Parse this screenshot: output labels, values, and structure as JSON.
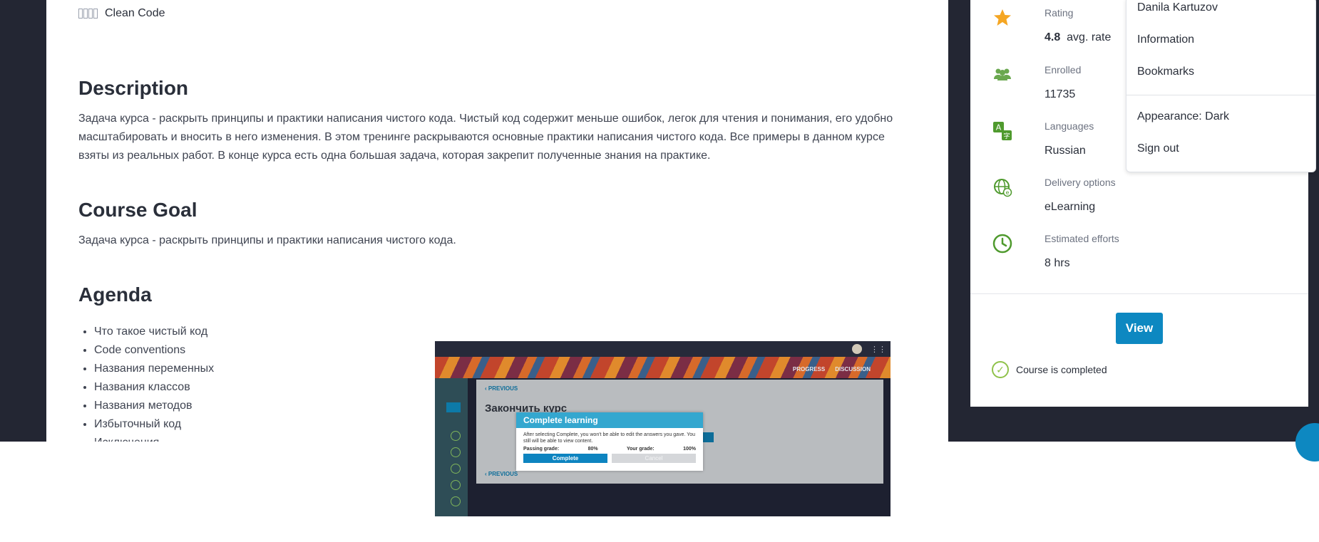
{
  "course": {
    "tag_label": "Clean Code"
  },
  "description": {
    "heading": "Description",
    "text": " Задача курса - раскрыть принципы и практики написания чистого кода. Чистый код содержит меньше ошибок, легок для чтения и понимания, его удобно масштабировать и вносить в него изменения. В этом тренинге раскрываются основные практики написания чистого кода. Все примеры в данном курсе взяты из реальных работ. В конце курса есть одна большая задача, которая закрепит полученные знания на практике."
  },
  "goal": {
    "heading": "Course Goal",
    "text": "Задача курса - раскрыть принципы и практики написания чистого кода."
  },
  "agenda": {
    "heading": "Agenda",
    "items": [
      "Что такое чистый код",
      "Code conventions",
      "Названия переменных",
      "Названия классов",
      "Названия методов",
      "Избыточный код",
      "Исключения"
    ]
  },
  "screenshot": {
    "nav_progress": "PROGRESS",
    "nav_discussion": "DISCUSSION",
    "previous": "PREVIOUS",
    "heading": "Закончить курс",
    "modal_title": "Complete learning",
    "modal_text": "After selecting Complete, you won't be able to edit the answers you gave. You still will be able to view content.",
    "passing_label": "Passing grade:",
    "passing_value": "80%",
    "your_label": "Your grade:",
    "your_value": "100%",
    "complete_btn": "Complete",
    "cancel_btn": "Cancel"
  },
  "info": {
    "rating_label": "Rating",
    "rating_value": "4.8",
    "rating_suffix": "avg. rate",
    "enrolled_label": "Enrolled",
    "enrolled_value": "11735",
    "languages_label": "Languages",
    "languages_value": "Russian",
    "delivery_label": "Delivery options",
    "delivery_value": "eLearning",
    "efforts_label": "Estimated efforts",
    "efforts_value": "8 hrs",
    "view_button": "View",
    "completed_text": "Course is completed"
  },
  "user_menu": {
    "user_name": "Danila Kartuzov",
    "information": "Information",
    "bookmarks": "Bookmarks",
    "appearance": "Appearance: Dark",
    "sign_out": "Sign out"
  },
  "colors": {
    "accent": "#0d88c1",
    "success": "#8fc24a",
    "star": "#f5a623",
    "dark_bg": "#232633"
  }
}
